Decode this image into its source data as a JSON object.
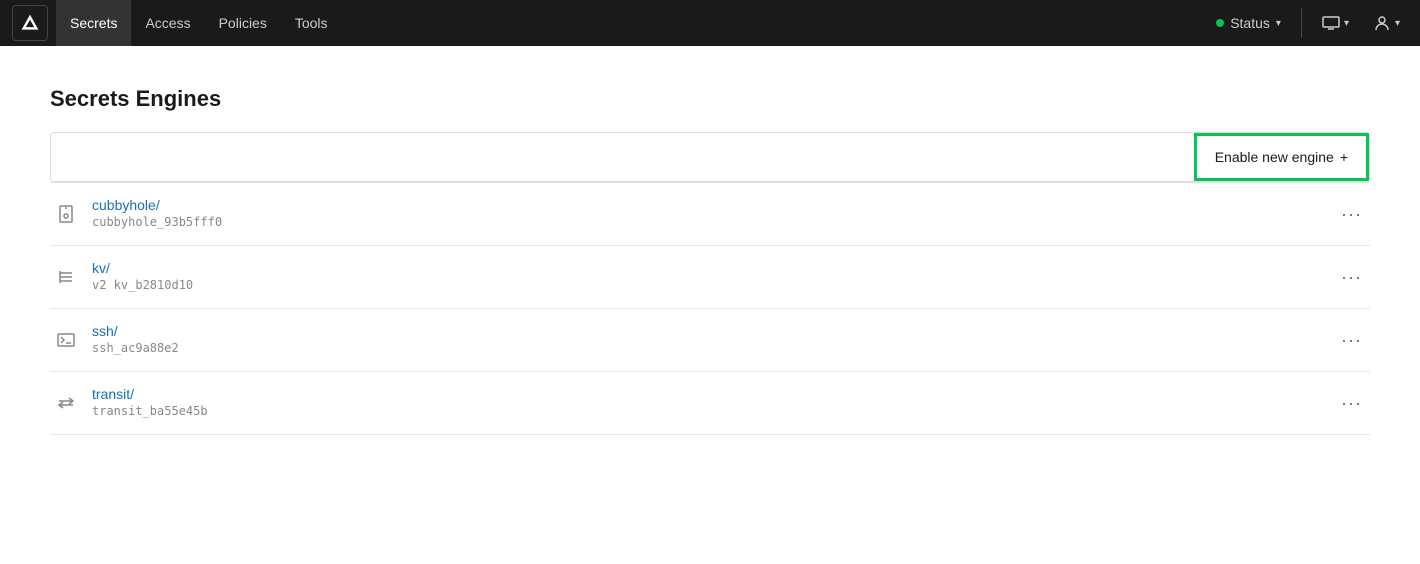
{
  "navbar": {
    "logo_label": "Vault",
    "nav_items": [
      {
        "id": "secrets",
        "label": "Secrets",
        "active": true
      },
      {
        "id": "access",
        "label": "Access",
        "active": false
      },
      {
        "id": "policies",
        "label": "Policies",
        "active": false
      },
      {
        "id": "tools",
        "label": "Tools",
        "active": false
      }
    ],
    "status_label": "Status",
    "status_dot_color": "#00c853"
  },
  "page": {
    "title": "Secrets Engines",
    "enable_button_label": "Enable new engine",
    "enable_button_icon": "+",
    "search_placeholder": ""
  },
  "engines": [
    {
      "id": "cubbyhole",
      "name": "cubbyhole/",
      "description": "cubbyhole_93b5fff0",
      "icon": "lock"
    },
    {
      "id": "kv",
      "name": "kv/",
      "description": "v2  kv_b2810d10",
      "icon": "list"
    },
    {
      "id": "ssh",
      "name": "ssh/",
      "description": "ssh_ac9a88e2",
      "icon": "terminal"
    },
    {
      "id": "transit",
      "name": "transit/",
      "description": "transit_ba55e45b",
      "icon": "arrows"
    }
  ],
  "icons": {
    "lock": "🔒",
    "list": "☰",
    "terminal": "▭",
    "arrows": "⇄",
    "chevron_down": "▾",
    "dots": "···"
  }
}
